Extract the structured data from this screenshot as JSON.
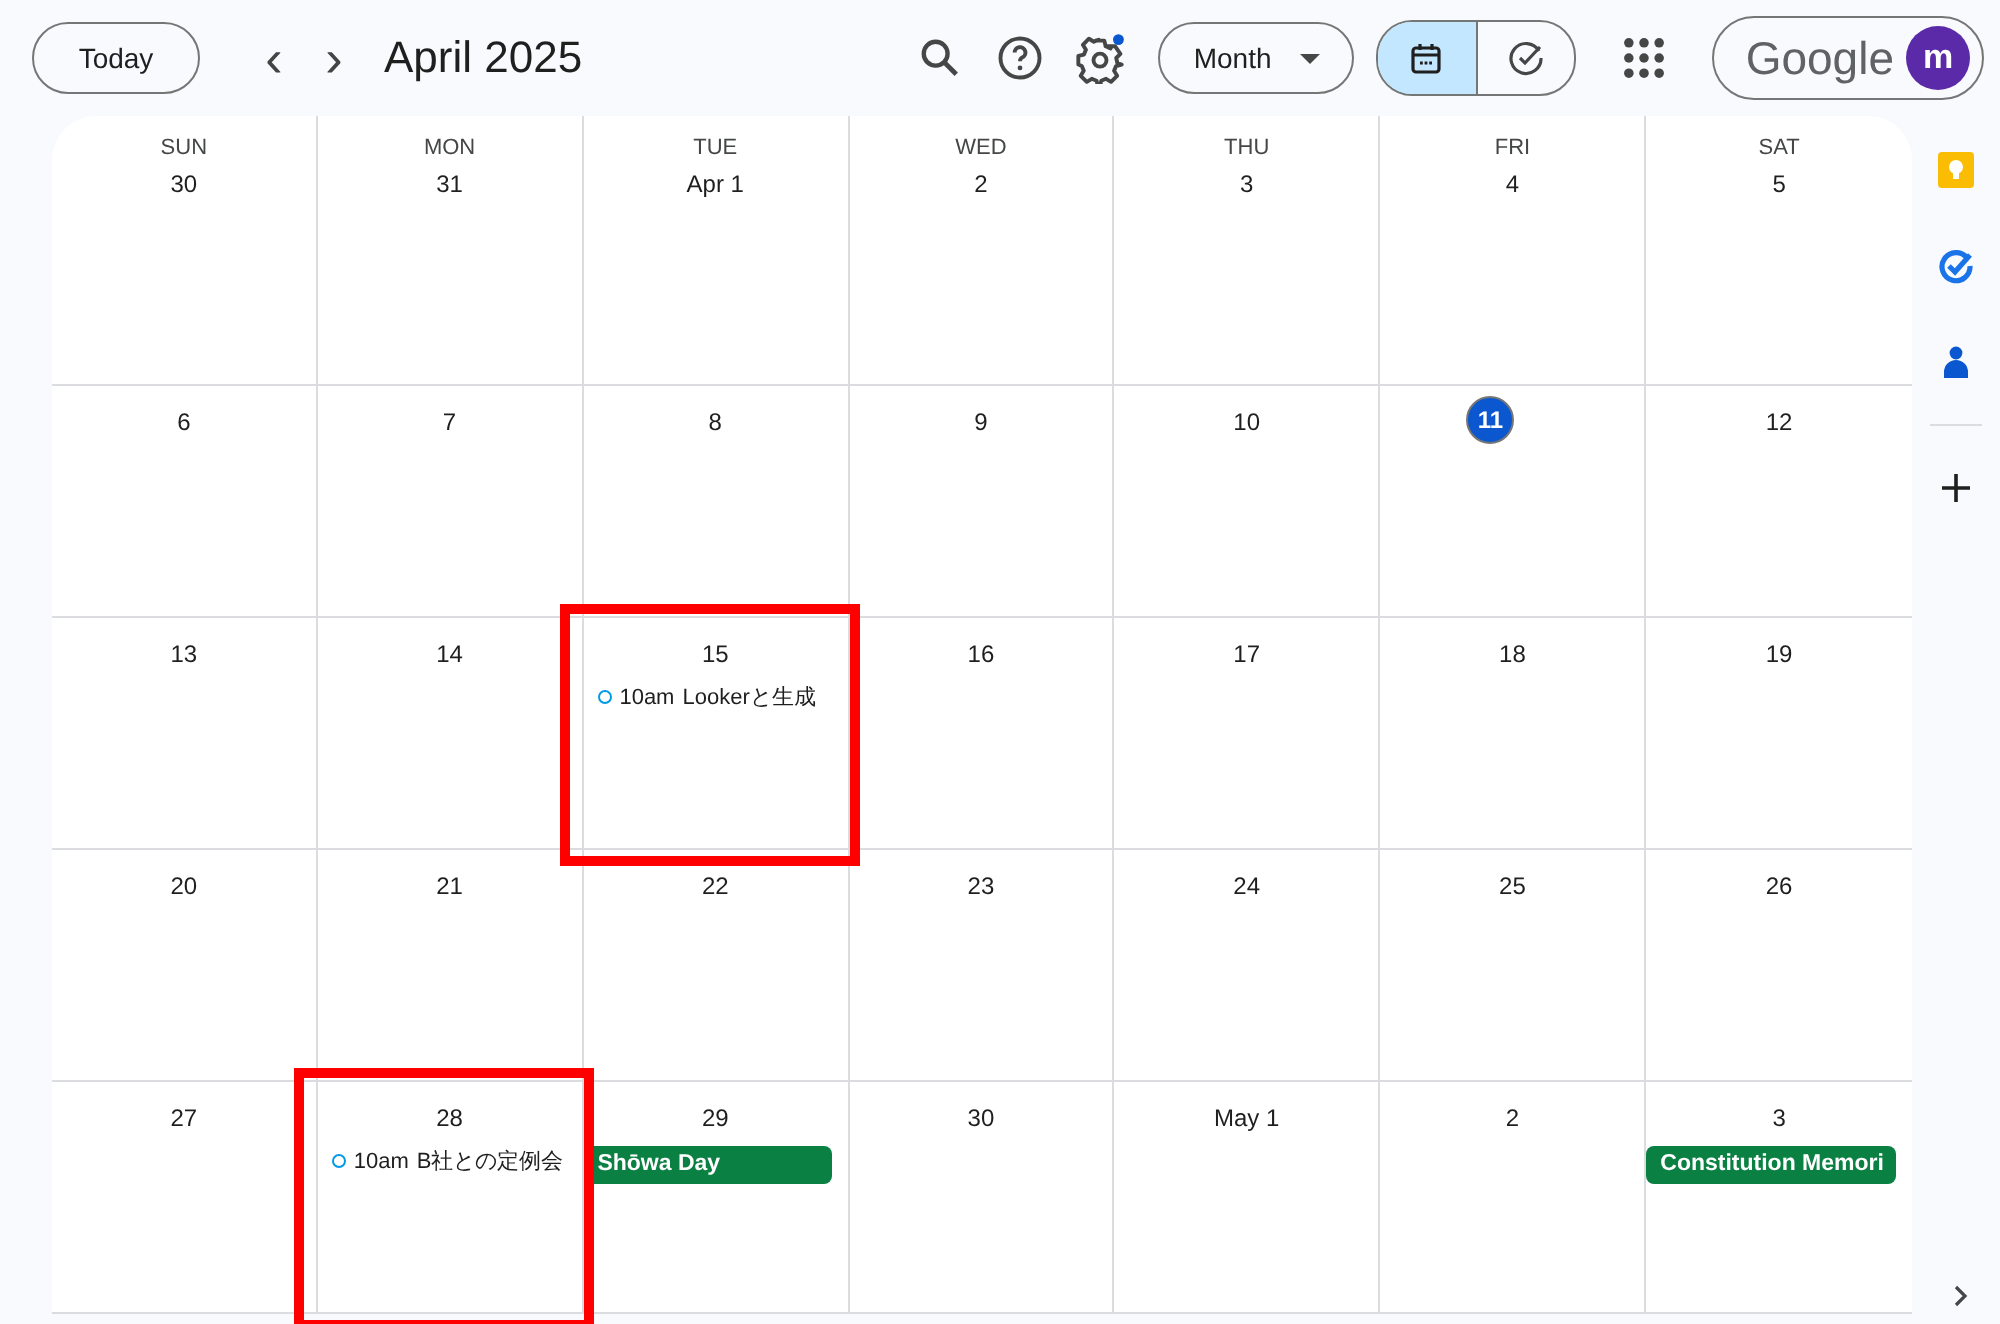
{
  "toolbar": {
    "today_button": "Today",
    "prev_label": "‹",
    "next_label": "›",
    "title": "April 2025",
    "view_dropdown": "Month",
    "view_toggle": [
      {
        "kind": "calendar",
        "selected": true
      },
      {
        "kind": "tasks",
        "selected": false
      }
    ],
    "account_label": "Google",
    "avatar_letter": "m"
  },
  "weekdays": [
    "SUN",
    "MON",
    "TUE",
    "WED",
    "THU",
    "FRI",
    "SAT"
  ],
  "weeks": [
    {
      "days": [
        {
          "date": "30"
        },
        {
          "date": "31"
        },
        {
          "date": "Apr 1"
        },
        {
          "date": "2"
        },
        {
          "date": "3"
        },
        {
          "date": "4"
        },
        {
          "date": "5"
        }
      ]
    },
    {
      "days": [
        {
          "date": "6"
        },
        {
          "date": "7"
        },
        {
          "date": "8"
        },
        {
          "date": "9"
        },
        {
          "date": "10"
        },
        {
          "date": "11",
          "today": true
        },
        {
          "date": "12"
        }
      ]
    },
    {
      "days": [
        {
          "date": "13"
        },
        {
          "date": "14"
        },
        {
          "date": "15",
          "highlighted": true,
          "events": [
            {
              "kind": "timed",
              "time": "10am",
              "title": "Lookerと生成"
            }
          ]
        },
        {
          "date": "16"
        },
        {
          "date": "17"
        },
        {
          "date": "18"
        },
        {
          "date": "19"
        }
      ]
    },
    {
      "days": [
        {
          "date": "20"
        },
        {
          "date": "21"
        },
        {
          "date": "22"
        },
        {
          "date": "23"
        },
        {
          "date": "24"
        },
        {
          "date": "25"
        },
        {
          "date": "26"
        }
      ]
    },
    {
      "days": [
        {
          "date": "27"
        },
        {
          "date": "28",
          "highlighted": true,
          "events": [
            {
              "kind": "timed",
              "time": "10am",
              "title": "B社との定例会"
            }
          ]
        },
        {
          "date": "29",
          "events": [
            {
              "kind": "allday",
              "title": "Shōwa Day",
              "color": "#0b8043"
            }
          ]
        },
        {
          "date": "30"
        },
        {
          "date": "May 1"
        },
        {
          "date": "2"
        },
        {
          "date": "3",
          "events": [
            {
              "kind": "allday",
              "title": "Constitution Memori",
              "color": "#0b8043"
            }
          ]
        }
      ]
    }
  ],
  "side_panel": [
    {
      "kind": "keep"
    },
    {
      "kind": "tasks"
    },
    {
      "kind": "contacts"
    },
    {
      "kind": "add"
    }
  ]
}
